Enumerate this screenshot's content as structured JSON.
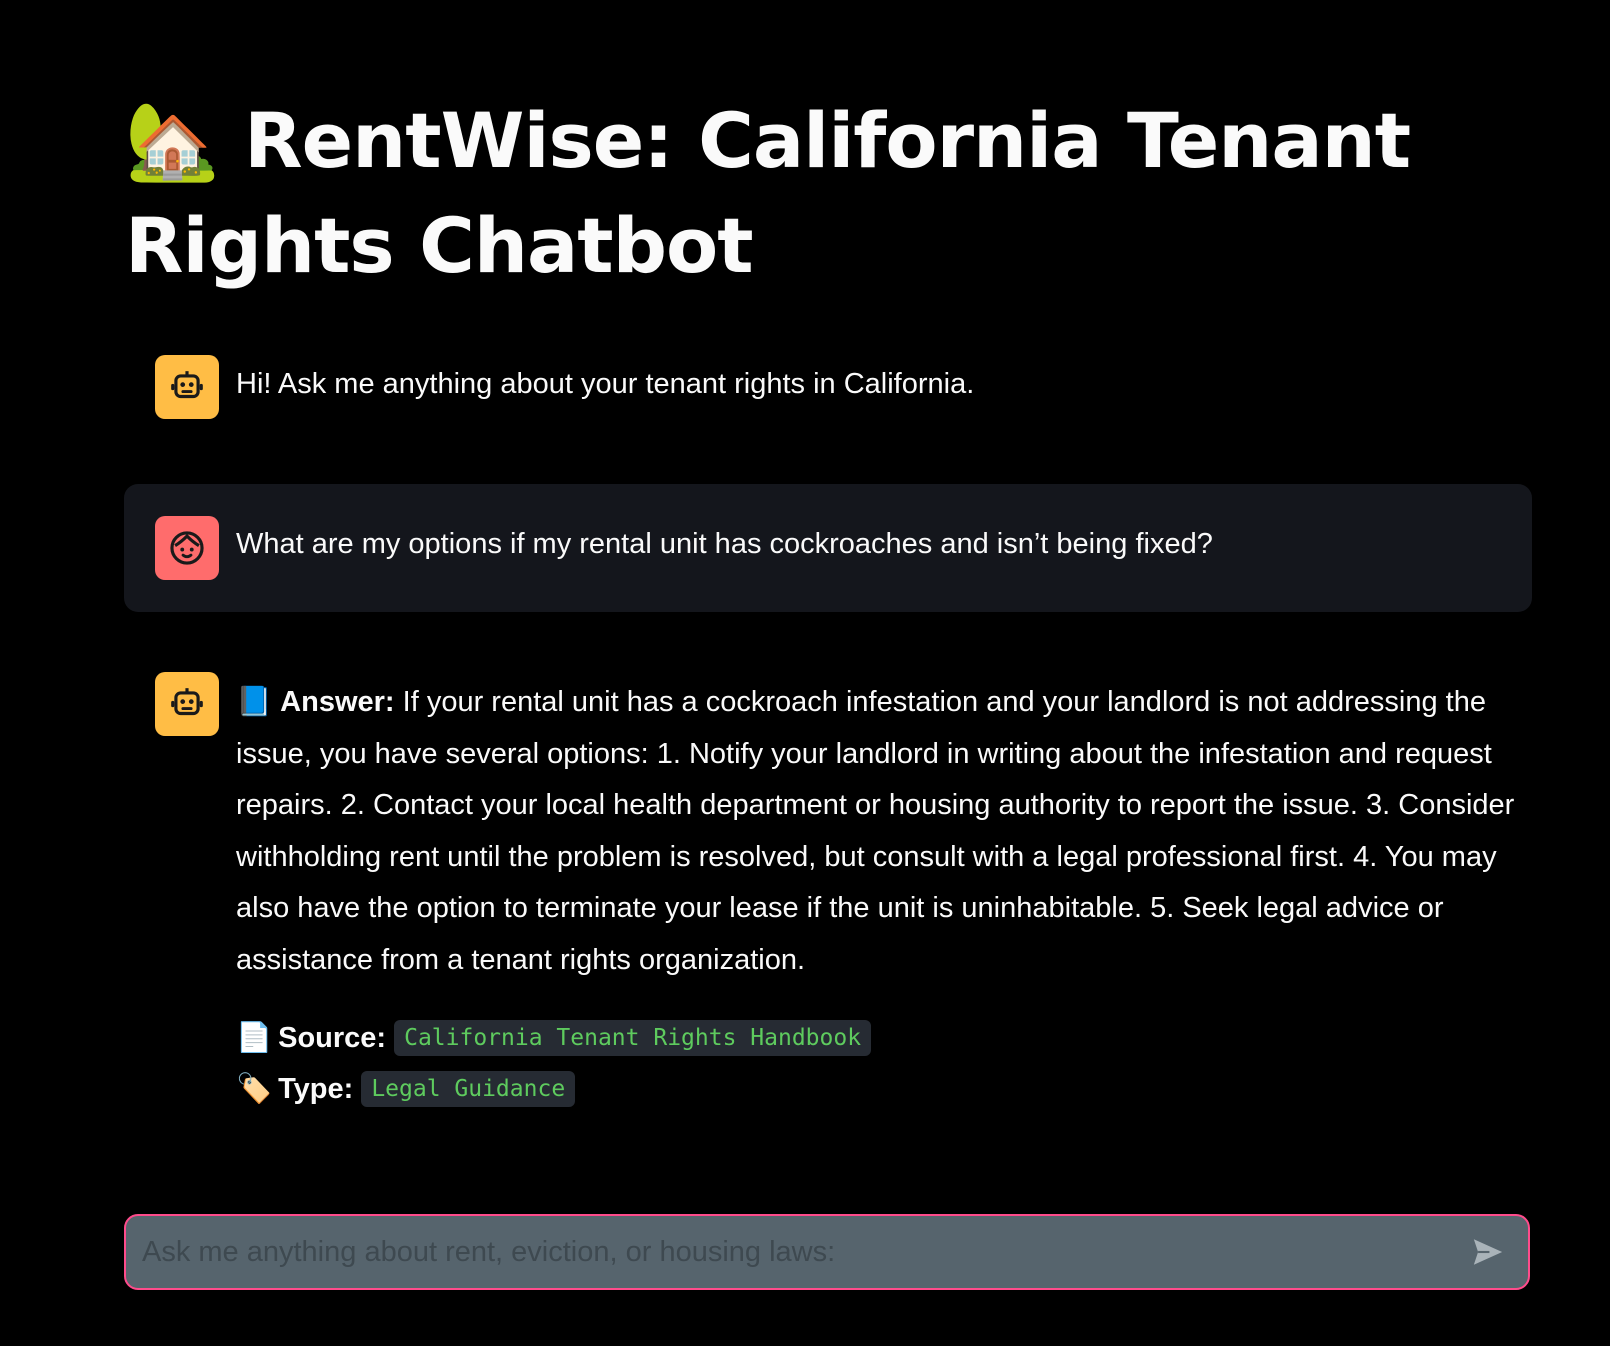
{
  "app": {
    "title_emoji": "🏡",
    "title": "RentWise: California Tenant Rights Chatbot"
  },
  "messages": [
    {
      "role": "assistant",
      "avatar_icon": "robot-icon",
      "text": "Hi! Ask me anything about your tenant rights in California."
    },
    {
      "role": "user",
      "avatar_icon": "user-face-icon",
      "text": "What are my options if my rental unit has cockroaches and isn’t being fixed?"
    },
    {
      "role": "assistant",
      "avatar_icon": "robot-icon",
      "answer_emoji": "📘",
      "answer_label": "Answer:",
      "answer_text": "If your rental unit has a cockroach infestation and your landlord is not addressing the issue, you have several options: 1. Notify your landlord in writing about the infestation and request repairs. 2. Contact your local health department or housing authority to report the issue. 3. Consider withholding rent until the problem is resolved, but consult with a legal professional first. 4. You may also have the option to terminate your lease if the unit is uninhabitable. 5. Seek legal advice or assistance from a tenant rights organization.",
      "source_emoji": "📄",
      "source_label": "Source:",
      "source_value": "California Tenant Rights Handbook",
      "type_emoji": "🏷️",
      "type_label": "Type:",
      "type_value": "Legal Guidance"
    }
  ],
  "chat_input": {
    "placeholder": "Ask me anything about rent, eviction, or housing laws:",
    "value": "",
    "send_icon": "send-icon"
  },
  "colors": {
    "background": "#000000",
    "assistant_avatar": "#ffbd45",
    "user_avatar": "#ff6c6c",
    "user_row_bg": "#14161c",
    "input_bg": "#56646d",
    "input_border": "#ff4b8b",
    "code_text": "#5ecb5e"
  }
}
